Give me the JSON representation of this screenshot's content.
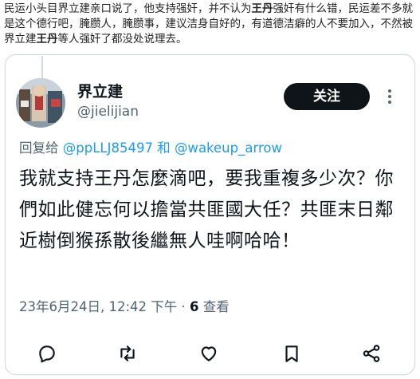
{
  "caption": {
    "part1": "民运小头目界立建亲口说了，他支持强奸，并不认为",
    "bold_name": "王丹",
    "part2": "强奸有什么错，民运差不多就是这个德行吧，腌臜人，腌臜事，建议洁身自好的，有道德洁癖的人不要加入，不然被界立建",
    "bold_name2": "王丹",
    "part3": "等人强奸了都没处说理去。"
  },
  "tweet": {
    "display_name": "界立建",
    "handle": "@jielijian",
    "follow_label": "关注",
    "reply_prefix": "回复给",
    "reply_mention1": "@ppLLJ85497",
    "reply_and": "和",
    "reply_mention2": "@wakeup_arrow",
    "body": "我就支持王丹怎麼滴吧，要我重複多少次？你們如此健忘何以擔當共匪國大任？共匪末日鄰近樹倒猴孫散後繼無人哇啊哈哈！",
    "date": "23年6月24日, 12:42 下午",
    "separator": "·",
    "views_count": "6",
    "views_label": "查看"
  },
  "icons": {
    "more": "more-vertical-icon",
    "reply": "reply-icon",
    "retweet": "retweet-icon",
    "like": "heart-icon",
    "bookmark": "bookmark-icon",
    "share": "share-icon"
  },
  "colors": {
    "link": "#1d9bf0",
    "secondary_text": "#536471",
    "follow_button": "#0f1419",
    "border": "#cfd9de"
  }
}
